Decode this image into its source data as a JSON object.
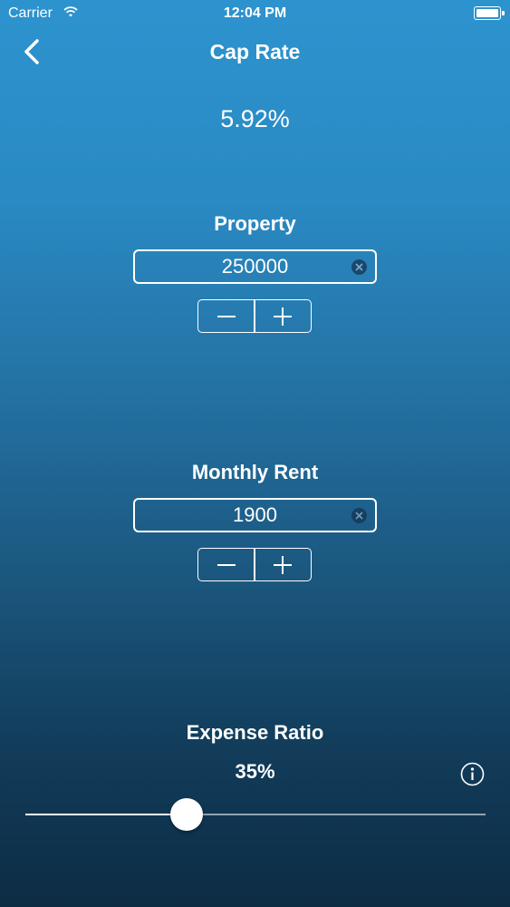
{
  "status_bar": {
    "carrier": "Carrier",
    "time": "12:04 PM"
  },
  "nav": {
    "title": "Cap Rate",
    "back_icon": "chevron-left-icon"
  },
  "result": {
    "value": "5.92%"
  },
  "property": {
    "label": "Property",
    "value": "250000",
    "minus": "−",
    "plus": "+"
  },
  "monthly_rent": {
    "label": "Monthly Rent",
    "value": "1900",
    "minus": "−",
    "plus": "+"
  },
  "expense_ratio": {
    "label": "Expense Ratio",
    "value_text": "35%",
    "slider_fraction": 0.35,
    "info_icon": "info-icon"
  }
}
